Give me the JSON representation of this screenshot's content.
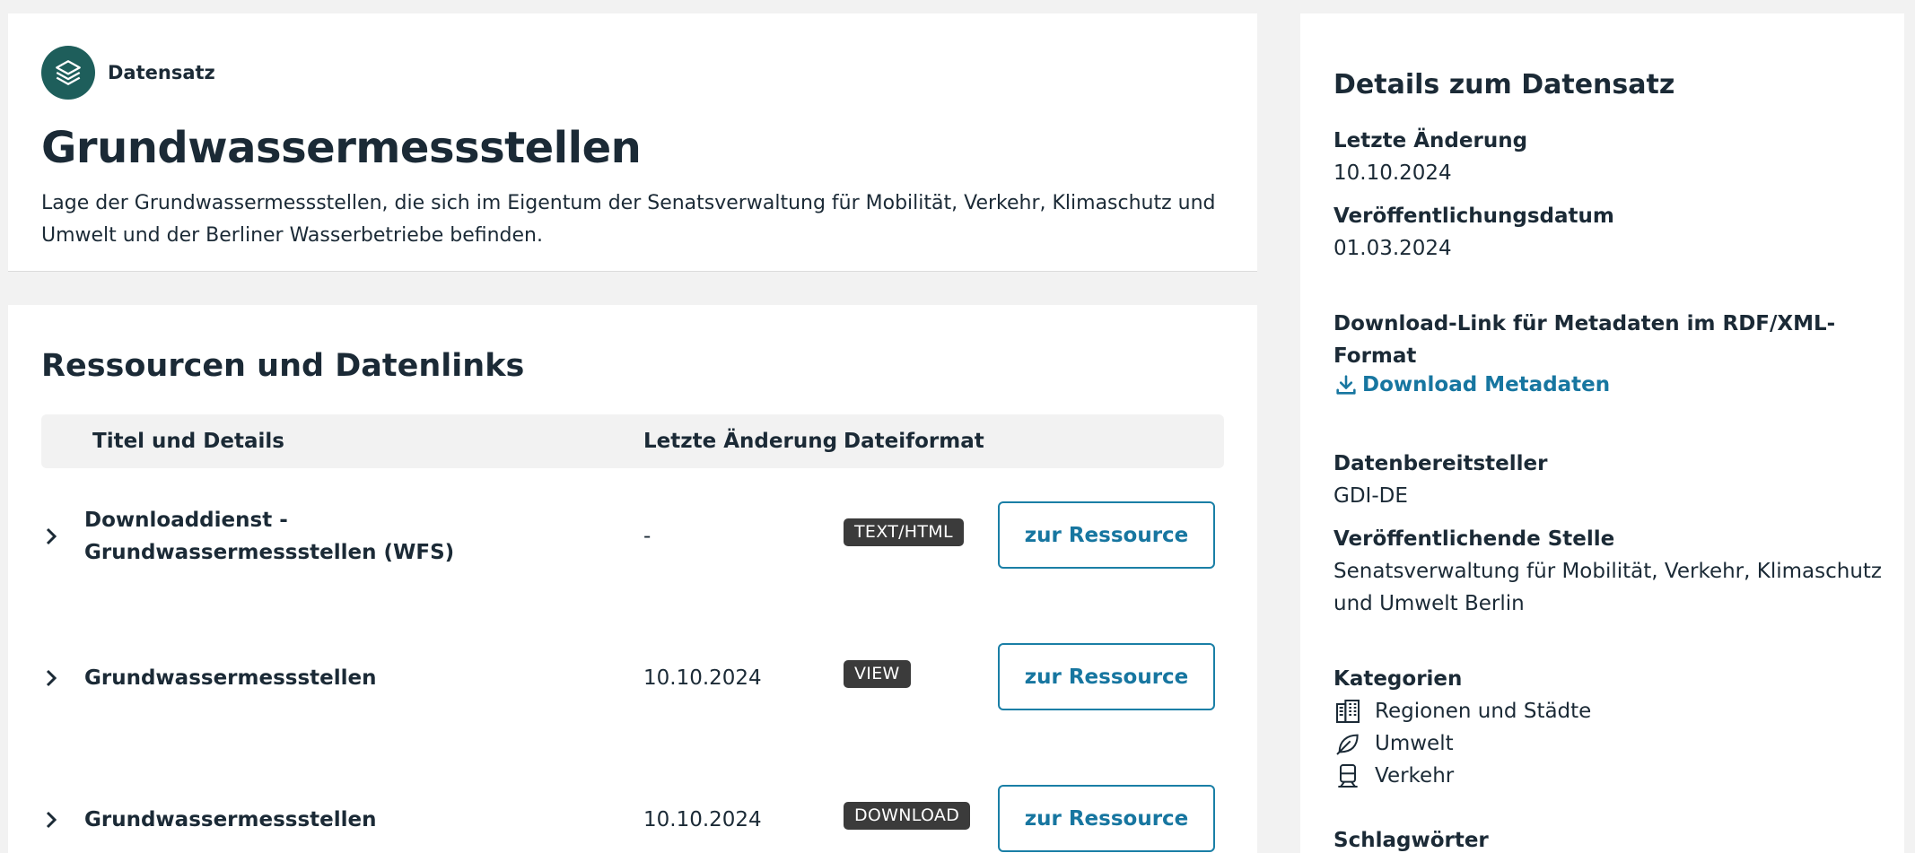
{
  "header": {
    "type_label": "Datensatz",
    "type_icon": "layers-icon",
    "title": "Grundwassermessstellen",
    "description": "Lage der Grundwassermessstellen, die sich im Eigentum der Senatsverwaltung für Mobilität, Verkehr, Klimaschutz und Umwelt und der Berliner Wasserbetriebe befinden."
  },
  "resources": {
    "section_title": "Ressourcen und Datenlinks",
    "columns": {
      "title": "Titel und Details",
      "last_change": "Letzte Änderung",
      "format": "Dateiformat"
    },
    "rows": [
      {
        "title": "Downloaddienst - Grundwassermessstellen (WFS)",
        "last_change": "-",
        "format": "TEXT/HTML",
        "button": "zur Ressource"
      },
      {
        "title": "Grundwassermessstellen",
        "last_change": "10.10.2024",
        "format": "VIEW",
        "button": "zur Ressource"
      },
      {
        "title": "Grundwassermessstellen",
        "last_change": "10.10.2024",
        "format": "DOWNLOAD",
        "button": "zur Ressource"
      }
    ]
  },
  "details": {
    "title": "Details zum Datensatz",
    "last_change_label": "Letzte Änderung",
    "last_change_value": "10.10.2024",
    "published_label": "Veröffentlichungsdatum",
    "published_value": "01.03.2024",
    "metadata_label": "Download-Link für Metadaten im RDF/XML-Format",
    "metadata_link": "Download Metadaten",
    "provider_label": "Datenbereitsteller",
    "provider_value": "GDI-DE",
    "publisher_label": "Veröffentlichende Stelle",
    "publisher_value": "Senatsverwaltung für Mobilität, Verkehr, Klimaschutz und Umwelt Berlin",
    "categories_label": "Kategorien",
    "categories": [
      {
        "label": "Regionen und Städte",
        "icon": "city-icon"
      },
      {
        "label": "Umwelt",
        "icon": "leaf-icon"
      },
      {
        "label": "Verkehr",
        "icon": "train-icon"
      }
    ],
    "keywords_label": "Schlagwörter"
  },
  "colors": {
    "accent": "#1776a0",
    "badge_bg": "#3b3b3b",
    "type_circle": "#1e5e5b",
    "page_bg": "#f2f2f2"
  }
}
